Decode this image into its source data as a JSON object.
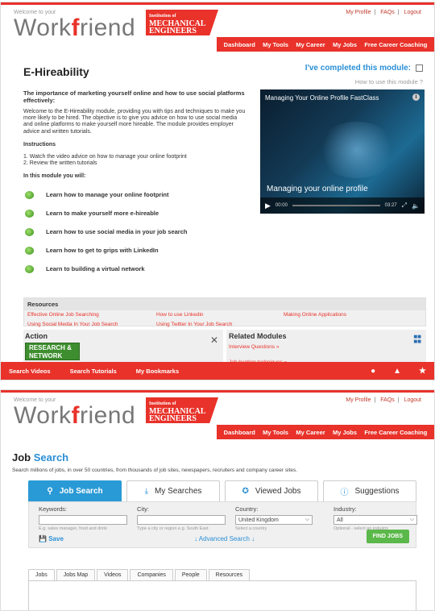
{
  "header": {
    "welcome": "Welcome to your",
    "logo_a": "Work",
    "logo_b": "f",
    "logo_c": "riend",
    "inst_small": "Institution of",
    "inst_big1": "MECHANICAL",
    "inst_big2": "ENGINEERS",
    "links": [
      "My Profile",
      "FAQs",
      "Logout"
    ],
    "nav": [
      "Dashboard",
      "My Tools",
      "My Career",
      "My Jobs",
      "Free Career Coaching"
    ]
  },
  "module": {
    "title": "E-Hireability",
    "completed_label": "I've completed this module:",
    "howto": "How to use this module ?",
    "heading": "The importance of marketing yourself online and how to use social platforms effectively:",
    "intro": "Welcome to the E-Hireability module, providing you with tips and techniques to make you more likely to be hired. The objective is to give you advice on how to use social media and online platforms to make yourself more hireable. The module provides employer advice and written tutorials.",
    "instructions_label": "Instructions",
    "instructions": [
      "1. Watch the video advice on how to manage your online footprint",
      "2. Review the written tutorials"
    ],
    "will_label": "In this module you will:",
    "goals": [
      "Learn how to manage your online footprint",
      "Learn to make yourself more e-hireable",
      "Learn how to use social media in your job search",
      "Learn how to get to grips with LinkedIn",
      "Learn to building a virtual network"
    ]
  },
  "video": {
    "title": "Managing Your Online Profile FastClass",
    "caption": "Managing your online profile",
    "time_start": "00:00",
    "time_end": "03:27"
  },
  "resources": {
    "title": "Resources",
    "links": [
      "Effective Online Job Searching",
      "How to use Linkedin",
      "Making Online Applications",
      "Using Social Media In Your Job Search",
      "Using Twitter In Your Job Search"
    ]
  },
  "action": {
    "title": "Action",
    "badge_line1": "RESEARCH &",
    "badge_line2": "NETWORK"
  },
  "related": {
    "title": "Related Modules",
    "links": [
      "Interview Questions »",
      "Job hunting techniques »"
    ]
  },
  "bottombar": [
    "Search Videos",
    "Search Tutorials",
    "My Bookmarks"
  ],
  "jobs": {
    "title_a": "Job",
    "title_b": "Search",
    "desc": "Search millions of jobs, in over 50 countries, from thousands of job sites, newspapers, recruiters and company career sites.",
    "tabs": [
      "Job Search",
      "My Searches",
      "Viewed Jobs",
      "Suggestions"
    ],
    "keywords_label": "Keywords:",
    "keywords_hint": "E.g. sales manager, food and drink",
    "city_label": "City:",
    "city_hint": "Type a city or region e.g. South East",
    "country_label": "Country:",
    "country_value": "United Kingdom",
    "country_hint": "Select a country",
    "industry_label": "Industry:",
    "industry_value": "All",
    "industry_hint": "Optional - select an industry",
    "save_label": "Save",
    "advanced_label": "Advanced Search",
    "find_label": "FIND JOBS",
    "subtabs": [
      "Jobs",
      "Jobs Map",
      "Videos",
      "Companies",
      "People",
      "Resources"
    ]
  }
}
